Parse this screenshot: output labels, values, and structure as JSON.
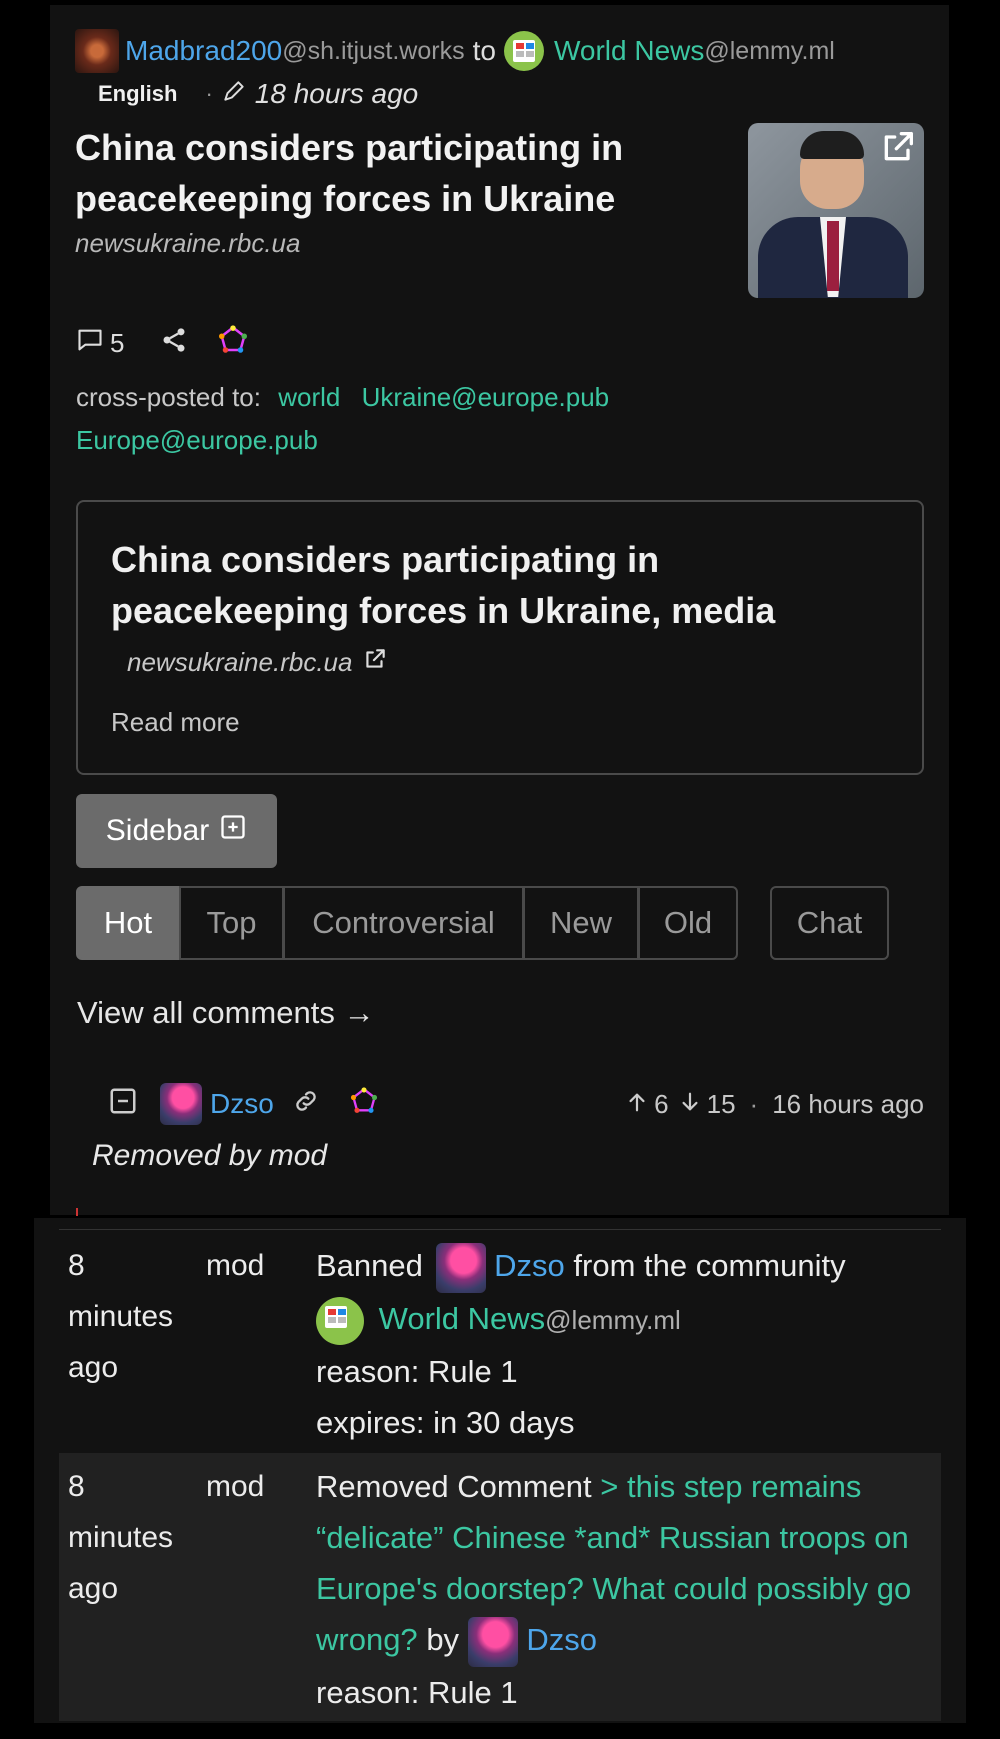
{
  "post": {
    "author": "Madbrad200",
    "author_instance": "@sh.itjust.works",
    "to_word": "to",
    "community": "World News",
    "community_instance": "@lemmy.ml",
    "language": "English",
    "separator": "·",
    "time": "18 hours ago",
    "title": "China considers participating in peacekeeping forces in Ukraine",
    "domain": "newsukraine.rbc.ua",
    "comment_count": "5",
    "crosspost_label": "cross-posted to:",
    "crossposts": [
      "world",
      "Ukraine@europe.pub",
      "Europe@europe.pub"
    ]
  },
  "embed": {
    "title": "China considers participating in peacekeeping forces in Ukraine, media",
    "domain": "newsukraine.rbc.ua",
    "read_more": "Read more"
  },
  "sidebar_button": "Sidebar",
  "sort_tabs": [
    "Hot",
    "Top",
    "Controversial",
    "New",
    "Old"
  ],
  "chat_tab": "Chat",
  "view_all": "View all comments →",
  "comment": {
    "author": "Dzso",
    "up": "6",
    "down": "15",
    "separator": "·",
    "time": "16 hours ago",
    "body": "Removed by mod"
  },
  "modlog": [
    {
      "when": "8 minutes ago",
      "mod": "mod",
      "action": "Banned",
      "user": "Dzso",
      "mid": "from the community",
      "community": "World News",
      "community_instance": "@lemmy.ml",
      "reason": "reason: Rule 1",
      "expires": "expires: in 30 days"
    },
    {
      "when": "8 minutes ago",
      "mod": "mod",
      "action": "Removed Comment",
      "quote": "> this step remains “delicate” Chinese *and* Russian troops on Europe's doorstep? What could possibly go wrong?",
      "by": "by",
      "user": "Dzso",
      "reason": "reason: Rule 1"
    }
  ],
  "colors": {
    "background": "#121212",
    "link_blue": "#4ea6ea",
    "link_teal": "#3cc7a2",
    "active_tab": "#6b6b6b"
  }
}
